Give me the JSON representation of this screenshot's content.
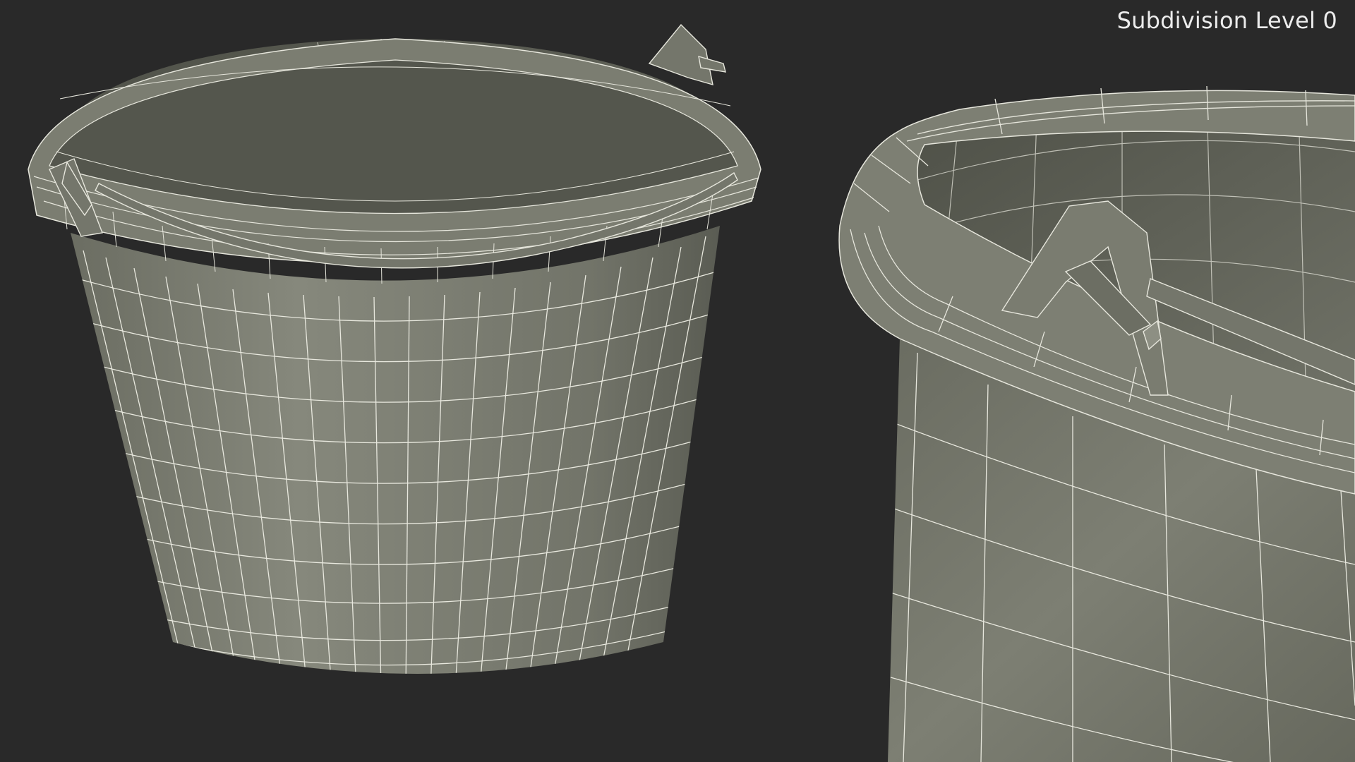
{
  "overlay": {
    "subdivision_label": "Subdivision Level 0"
  },
  "scene": {
    "background_color": "#292929",
    "mesh_fill_light": "#84867a",
    "mesh_fill_dark": "#5e6056",
    "wire_color": "#e6e6dc",
    "views": [
      {
        "name": "bucket-full-view"
      },
      {
        "name": "bucket-rim-closeup"
      }
    ]
  }
}
